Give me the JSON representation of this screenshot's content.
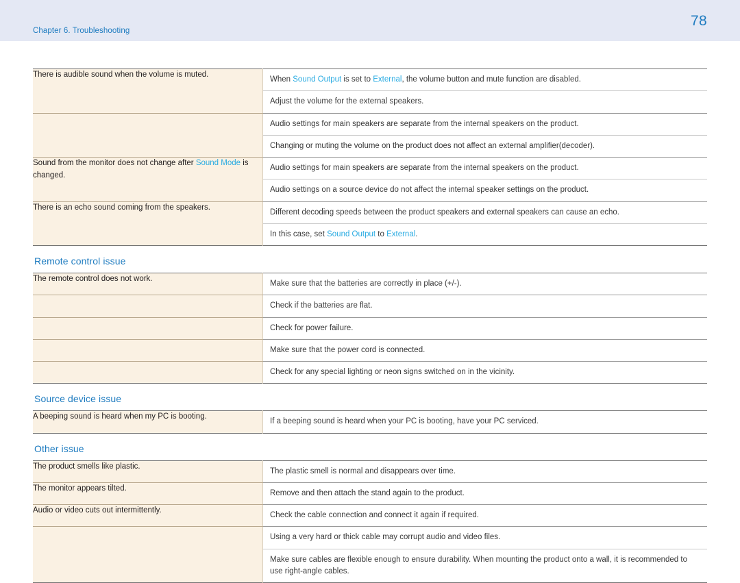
{
  "header": {
    "chapter": "Chapter 6. Troubleshooting",
    "page_number": "78",
    "accent_color": "#1f7cc0",
    "band_color": "#e4e8f4",
    "term_color": "#29abe2",
    "symptom_cell_color": "#faf1e3"
  },
  "sections": [
    {
      "id": "sound-issue-continued",
      "heading": null,
      "rows": [
        {
          "symptom": [
            {
              "t": "There is audible sound when the volume is muted.",
              "k": "plain"
            }
          ],
          "solutions": [
            [
              {
                "t": "When ",
                "k": "plain"
              },
              {
                "t": "Sound Output",
                "k": "term"
              },
              {
                "t": " is set to ",
                "k": "plain"
              },
              {
                "t": "External",
                "k": "term"
              },
              {
                "t": ", the volume button and mute function are disabled.",
                "k": "plain"
              }
            ],
            [
              {
                "t": "Adjust the volume for the external speakers.",
                "k": "plain"
              }
            ]
          ]
        },
        {
          "symptom": [],
          "solutions": [
            [
              {
                "t": "Audio settings for main speakers are separate from the internal speakers on the product.",
                "k": "plain"
              }
            ],
            [
              {
                "t": "Changing or muting the volume on the product does not affect an external amplifier(decoder).",
                "k": "plain"
              }
            ]
          ]
        },
        {
          "symptom": [
            {
              "t": "Sound from the monitor does not change after ",
              "k": "plain"
            },
            {
              "t": "Sound Mode",
              "k": "term"
            },
            {
              "t": " is changed.",
              "k": "plain"
            }
          ],
          "solutions": [
            [
              {
                "t": "Audio settings for main speakers are separate from the internal speakers on the product.",
                "k": "plain"
              }
            ],
            [
              {
                "t": "Audio settings on a source device do not affect the internal speaker settings on the product.",
                "k": "plain"
              }
            ]
          ]
        },
        {
          "symptom": [
            {
              "t": "There is an echo sound coming from the speakers.",
              "k": "plain"
            }
          ],
          "solutions": [
            [
              {
                "t": "Different decoding speeds between the product speakers and external speakers can cause an echo.",
                "k": "plain"
              }
            ],
            [
              {
                "t": "In this case, set ",
                "k": "plain"
              },
              {
                "t": "Sound Output",
                "k": "term"
              },
              {
                "t": " to ",
                "k": "plain"
              },
              {
                "t": "External",
                "k": "term"
              },
              {
                "t": ".",
                "k": "plain"
              }
            ]
          ]
        }
      ]
    },
    {
      "id": "remote-control-issue",
      "heading": "Remote control issue",
      "rows": [
        {
          "symptom": [
            {
              "t": "The remote control does not work.",
              "k": "plain"
            }
          ],
          "solutions": [
            [
              {
                "t": "Make sure that the batteries are correctly in place (+/-).",
                "k": "plain"
              }
            ]
          ]
        },
        {
          "symptom": [],
          "solutions": [
            [
              {
                "t": "Check if the batteries are flat.",
                "k": "plain"
              }
            ]
          ]
        },
        {
          "symptom": [],
          "solutions": [
            [
              {
                "t": "Check for power failure.",
                "k": "plain"
              }
            ]
          ]
        },
        {
          "symptom": [],
          "solutions": [
            [
              {
                "t": "Make sure that the power cord is connected.",
                "k": "plain"
              }
            ]
          ]
        },
        {
          "symptom": [],
          "solutions": [
            [
              {
                "t": "Check for any special lighting or neon signs switched on in the vicinity.",
                "k": "plain"
              }
            ]
          ]
        }
      ]
    },
    {
      "id": "source-device-issue",
      "heading": "Source device issue",
      "rows": [
        {
          "symptom": [
            {
              "t": "A beeping sound is heard when my PC is booting.",
              "k": "plain"
            }
          ],
          "solutions": [
            [
              {
                "t": "If a beeping sound is heard when your PC is booting, have your PC serviced.",
                "k": "plain"
              }
            ]
          ]
        }
      ]
    },
    {
      "id": "other-issue",
      "heading": "Other issue",
      "rows": [
        {
          "symptom": [
            {
              "t": "The product smells like plastic.",
              "k": "plain"
            }
          ],
          "solutions": [
            [
              {
                "t": "The plastic smell is normal and disappears over time.",
                "k": "plain"
              }
            ]
          ]
        },
        {
          "symptom": [
            {
              "t": "The monitor appears tilted.",
              "k": "plain"
            }
          ],
          "solutions": [
            [
              {
                "t": "Remove and then attach the stand again to the product.",
                "k": "plain"
              }
            ]
          ]
        },
        {
          "symptom": [
            {
              "t": "Audio or video cuts out intermittently.",
              "k": "plain"
            }
          ],
          "solutions": [
            [
              {
                "t": "Check the cable connection and connect it again if required.",
                "k": "plain"
              }
            ]
          ]
        },
        {
          "symptom": [],
          "solutions": [
            [
              {
                "t": "Using a very hard or thick cable may corrupt audio and video files.",
                "k": "plain"
              }
            ],
            [
              {
                "t": "Make sure cables are flexible enough to ensure durability. When mounting the product onto a wall, it is recommended to use right-angle cables.",
                "k": "plain"
              }
            ]
          ]
        }
      ]
    }
  ]
}
